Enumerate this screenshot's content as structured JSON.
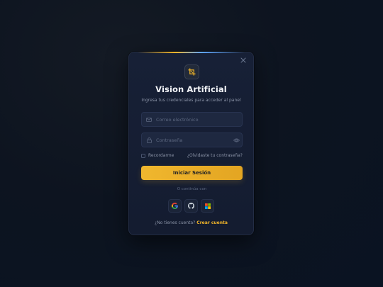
{
  "modal": {
    "close_icon": "close-icon",
    "logo_icon": "crop-icon",
    "title": "Vision Artificial",
    "subtitle": "Ingresa tus credenciales para acceder al panel"
  },
  "form": {
    "email": {
      "icon": "mail-icon",
      "placeholder": "Correo electrónico",
      "value": ""
    },
    "password": {
      "icon": "lock-icon",
      "placeholder": "Contraseña",
      "value": "",
      "toggle_icon": "eye-icon"
    },
    "remember_label": "Recordarme",
    "remember_checked": false,
    "forgot_label": "¿Olvidaste tu contraseña?",
    "submit_label": "Iniciar Sesión"
  },
  "divider_text": "O continúa con",
  "social": [
    {
      "name": "google",
      "icon": "google-icon"
    },
    {
      "name": "github",
      "icon": "github-icon"
    },
    {
      "name": "microsoft",
      "icon": "microsoft-icon"
    }
  ],
  "signup": {
    "prompt": "¿No tienes cuenta?",
    "link": "Crear cuenta"
  },
  "colors": {
    "accent": "#f0b429",
    "background": "#0d1420",
    "card": "#172036",
    "field": "#1e2840"
  }
}
